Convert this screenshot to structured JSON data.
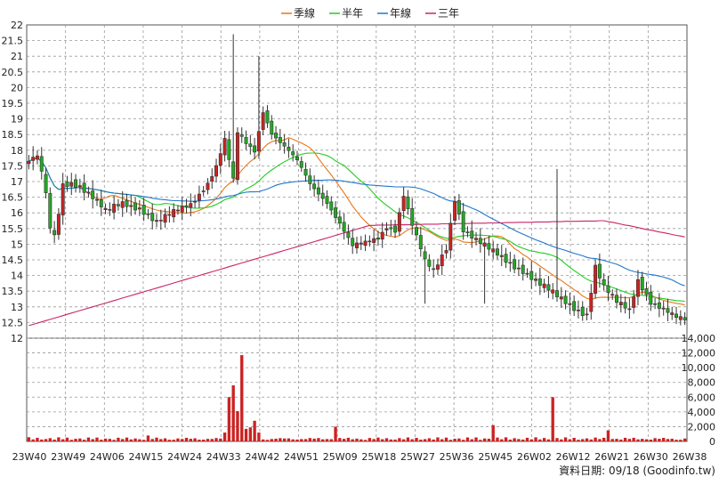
{
  "chart_data": {
    "type": "candlestick",
    "legend": [
      {
        "name": "季線",
        "color": "#e8761a"
      },
      {
        "name": "半年",
        "color": "#22cc22"
      },
      {
        "name": "年線",
        "color": "#2277cc"
      },
      {
        "name": "三年",
        "color": "#cc2266"
      }
    ],
    "legend_position": "top-center",
    "x_tick_labels": [
      "23W40",
      "23W49",
      "24W06",
      "24W15",
      "24W24",
      "24W33",
      "24W42",
      "24W51",
      "25W09",
      "25W18",
      "25W27",
      "25W36",
      "25W45",
      "26W02",
      "26W12",
      "26W21",
      "26W30",
      "26W38"
    ],
    "price_axis": {
      "min": 12,
      "max": 22,
      "step": 0.5,
      "ticks": [
        "12",
        "12.5",
        "13",
        "13.5",
        "14",
        "14.5",
        "15",
        "15.5",
        "16",
        "16.5",
        "17",
        "17.5",
        "18",
        "18.5",
        "19",
        "19.5",
        "20",
        "20.5",
        "21",
        "21.5",
        "22"
      ]
    },
    "volume_axis": {
      "min": 0,
      "max": 14000,
      "step": 2000,
      "ticks": [
        "0",
        "2,000",
        "4,000",
        "6,000",
        "8,000",
        "10,000",
        "12,000",
        "14,000"
      ]
    },
    "grid": true,
    "up_color": "#cc2222",
    "down_color": "#22aa22",
    "weeks": 155,
    "ohlc": [],
    "volume": [],
    "moving_averages": {
      "季線": [],
      "半年": [],
      "年線": [],
      "三年": []
    },
    "credit": "資料日期: 09/18  (Goodinfo.tw)"
  }
}
